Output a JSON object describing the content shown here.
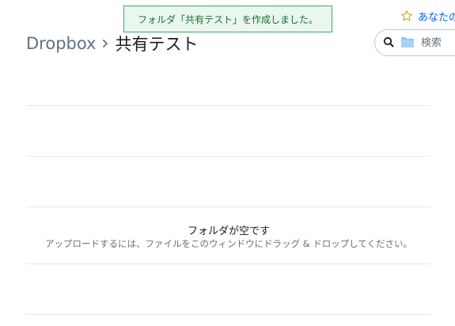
{
  "toast": {
    "message": "フォルダ「共有テスト」を作成しました。",
    "status_color": "#3fae64"
  },
  "header": {
    "star_link_label": "あなたの",
    "star_icon": "star-icon"
  },
  "breadcrumb": {
    "root": "Dropbox",
    "separator_icon": "chevron-right-icon",
    "current": "共有テスト"
  },
  "search": {
    "placeholder": "検索",
    "search_icon": "search-icon",
    "scope_icon": "folder-icon"
  },
  "empty_state": {
    "title": "フォルダが空です",
    "subtitle": "アップロードするには、ファイルをこのウィンドウにドラッグ & ドロップしてください。"
  },
  "colors": {
    "accent": "#0061fe",
    "folder_icon": "#8fc4f5",
    "divider": "#e6e8eb"
  }
}
